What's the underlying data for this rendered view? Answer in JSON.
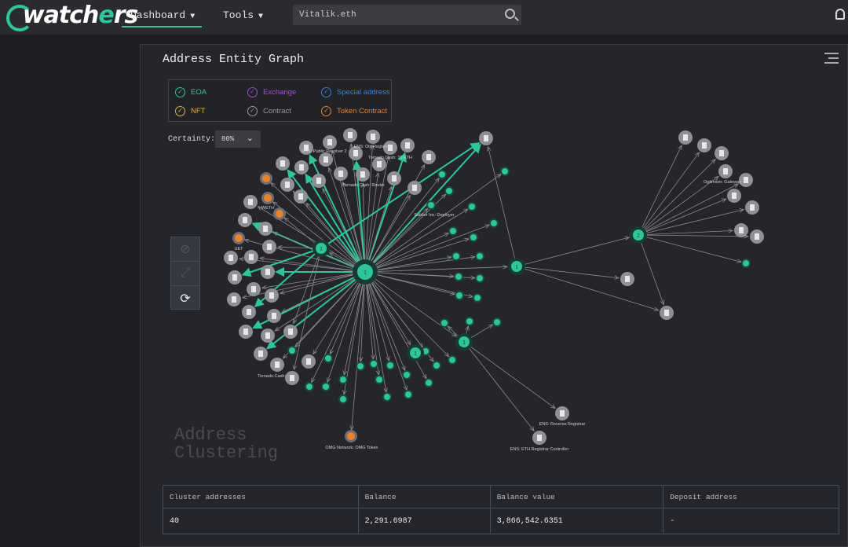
{
  "app": {
    "logo": "watchers"
  },
  "nav": {
    "dashboard": "Dashboard",
    "tools": "Tools",
    "search_value": "Vitalik.eth"
  },
  "panel": {
    "title": "Address Entity Graph",
    "watermark_line1": "Address",
    "watermark_line2": "Clustering"
  },
  "legend": [
    {
      "label": "EOA",
      "color": "#2fc59a"
    },
    {
      "label": "Exchange",
      "color": "#9b4fd8"
    },
    {
      "label": "Special address",
      "color": "#3b7fe0"
    },
    {
      "label": "NFT",
      "color": "#e0b23a"
    },
    {
      "label": "Contract",
      "color": "#9a9a9a"
    },
    {
      "label": "Token Contract",
      "color": "#e8822e"
    }
  ],
  "certainty": {
    "label": "Certainty:",
    "value": "80%"
  },
  "graph": {
    "colors": {
      "eoa": "#2fc59a",
      "contract": "#8e9096",
      "token": "#e8822e",
      "edge": "#8a8c90"
    },
    "hub_labels": [
      "1",
      "1",
      "1",
      "2",
      "1",
      "1"
    ],
    "node_labels": [
      "ENS: Public Resolver 2",
      "ENS: Old Registrar",
      "Tornado.Cash: 10 ETH",
      "Tornado.Cash: Router",
      "WETH",
      "UET",
      "Sablier Inc: Deployer",
      "Tornado.Cash:",
      "OMG Network: OMG Token",
      "ENS: Reverse Registrar",
      "ENS: ETH Registrar Controller",
      "Optimism: Gateway"
    ]
  },
  "table": {
    "headers": [
      "Cluster addresses",
      "Balance",
      "Balance value",
      "Deposit address"
    ],
    "row": [
      "40",
      "2,291.6987",
      "3,866,542.6351",
      "-"
    ]
  }
}
